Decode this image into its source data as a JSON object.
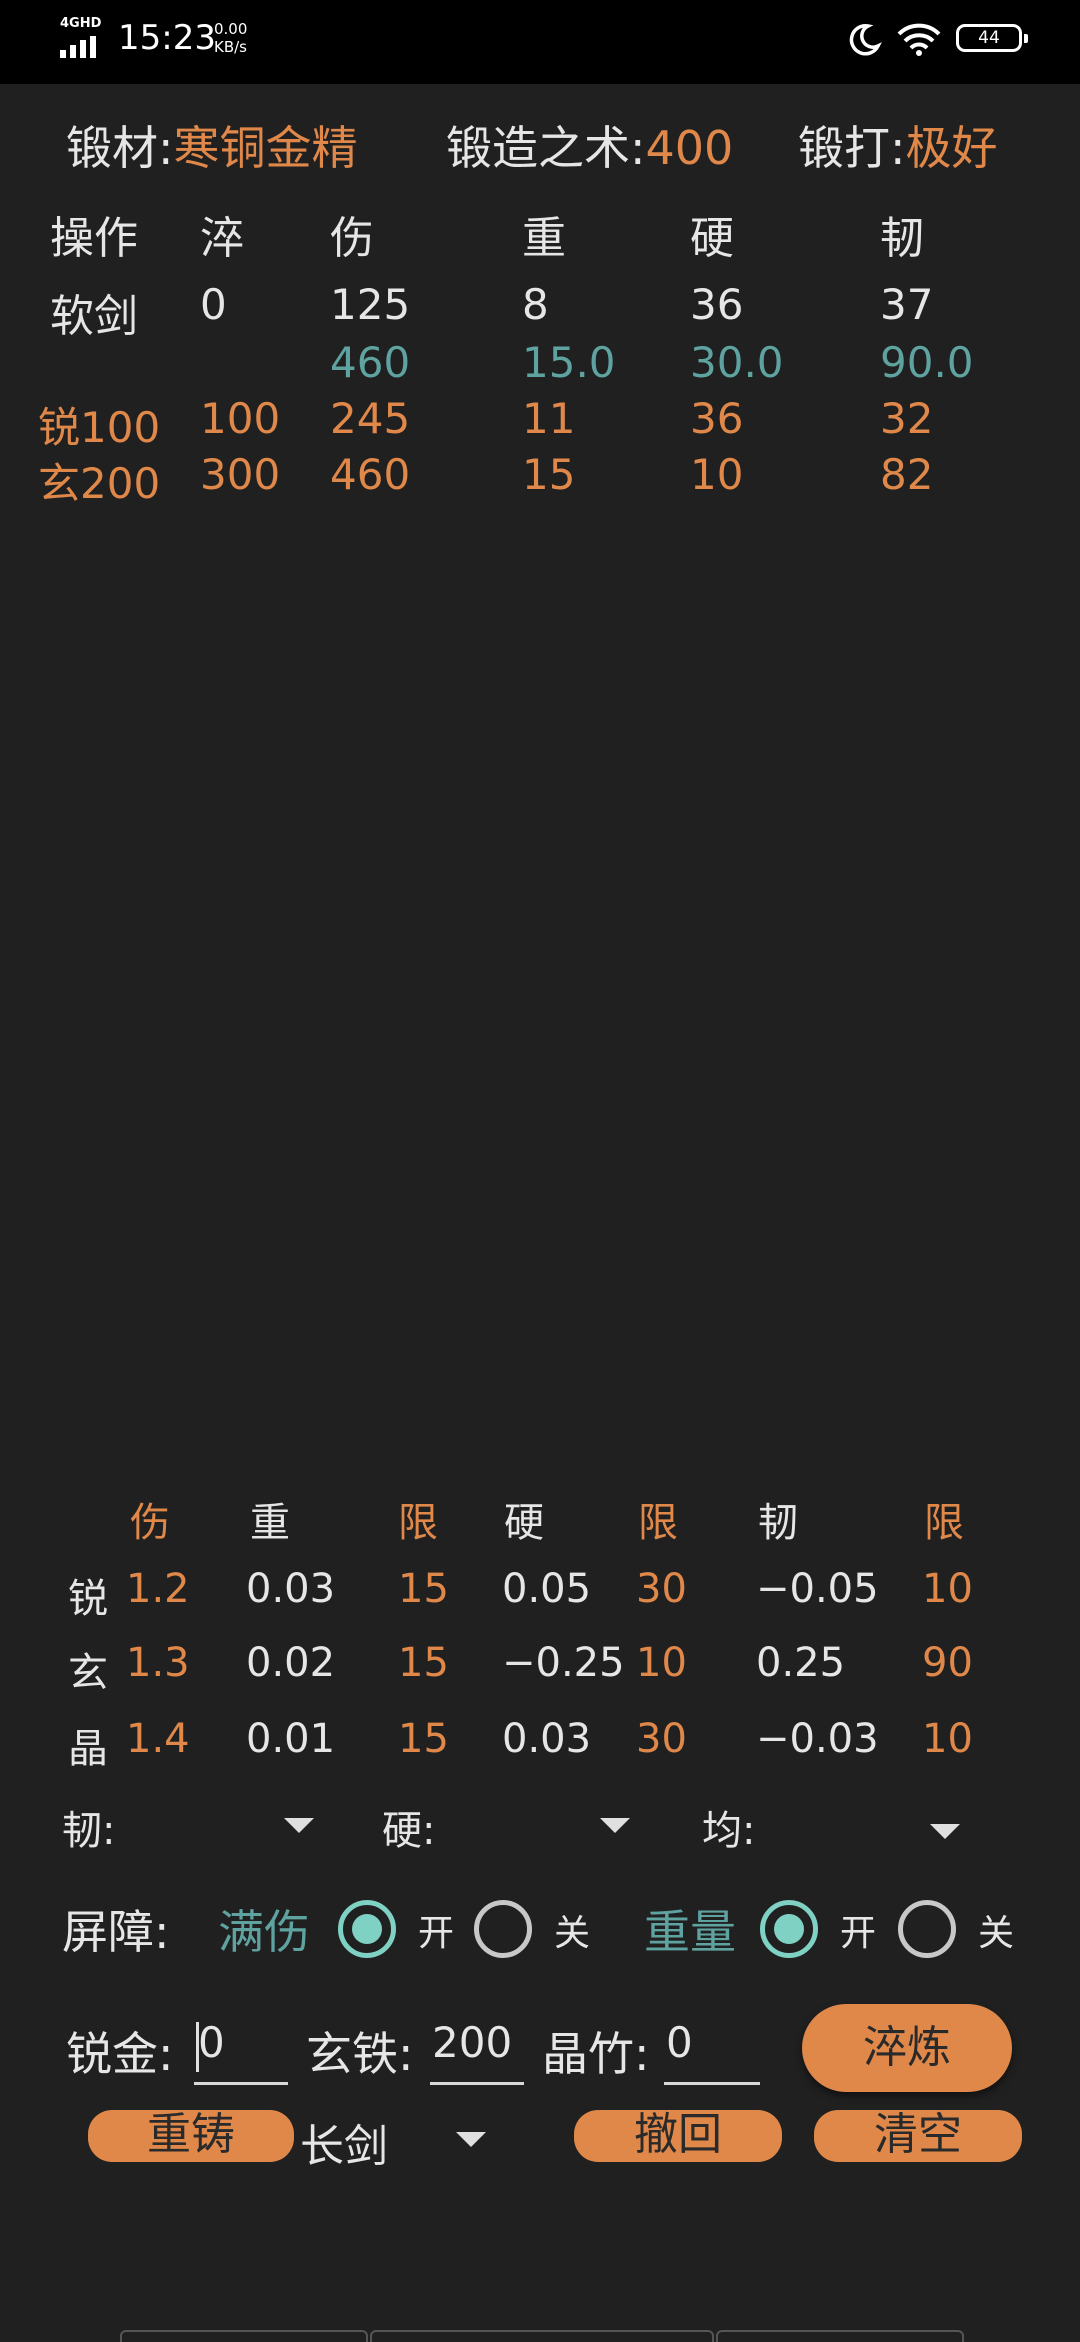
{
  "status_bar": {
    "network": "4GHD",
    "time": "15:23",
    "speed_value": "0.00",
    "speed_unit": "KB/s",
    "battery": "44"
  },
  "header": {
    "material_label": "锻材:",
    "material_value": "寒铜金精",
    "skill_label": "锻造之术:",
    "skill_value": "400",
    "forge_label": "锻打:",
    "forge_value": "极好"
  },
  "top_table": {
    "headers": [
      "操作",
      "淬",
      "伤",
      "重",
      "硬",
      "韧"
    ],
    "rows": [
      [
        "软剑",
        "0",
        "125",
        "8",
        "36",
        "37"
      ],
      [
        "",
        "",
        "460",
        "15.0",
        "30.0",
        "90.0"
      ],
      [
        "锐100",
        "100",
        "245",
        "11",
        "36",
        "32"
      ],
      [
        "玄200",
        "300",
        "460",
        "15",
        "10",
        "82"
      ]
    ]
  },
  "coef_table": {
    "headers": [
      "伤",
      "重",
      "限",
      "硬",
      "限",
      "韧",
      "限"
    ],
    "rows": [
      [
        "锐",
        "1.2",
        "0.03",
        "15",
        "0.05",
        "30",
        "−0.05",
        "10"
      ],
      [
        "玄",
        "1.3",
        "0.02",
        "15",
        "−0.25",
        "10",
        "0.25",
        "90"
      ],
      [
        "晶",
        "1.4",
        "0.01",
        "15",
        "0.03",
        "30",
        "−0.03",
        "10"
      ]
    ]
  },
  "dropdowns": {
    "toughness_label": "韧:",
    "hardness_label": "硬:",
    "balance_label": "均:"
  },
  "barrier": {
    "label": "屏障:",
    "full_damage_label": "满伤",
    "on_label": "开",
    "off_label": "关",
    "weight_label": "重量",
    "full_damage_state": "开",
    "weight_state": "开"
  },
  "inputs": {
    "rui_label": "锐金:",
    "rui_value": "0",
    "xuan_label": "玄铁:",
    "xuan_value": "200",
    "jing_label": "晶竹:",
    "jing_value": "0"
  },
  "buttons": {
    "temper": "淬炼",
    "recast": "重铸",
    "weapon_type": "长剑",
    "undo": "撤回",
    "clear": "清空"
  },
  "colors": {
    "accent": "#e0884a",
    "teal": "#5fa3a0",
    "radio": "#7fd1c4",
    "background": "#202020"
  }
}
